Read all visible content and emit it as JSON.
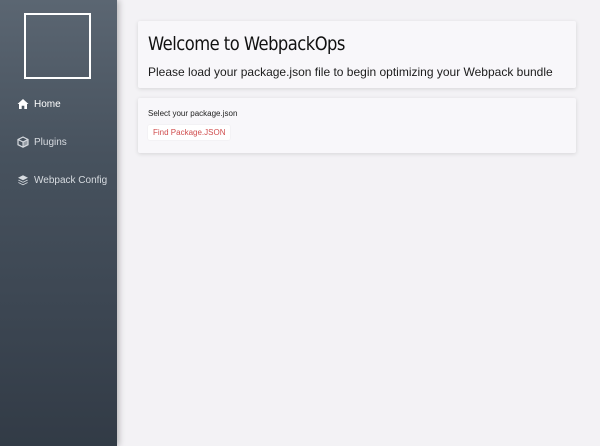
{
  "sidebar": {
    "items": [
      {
        "label": "Home",
        "icon": "home-icon",
        "active": true
      },
      {
        "label": "Plugins",
        "icon": "cube-icon",
        "active": false
      },
      {
        "label": "Webpack Config",
        "icon": "layers-icon",
        "active": false
      }
    ]
  },
  "main": {
    "title": "Welcome to WebpackOps",
    "subtitle": "Please load your package.json file to begin optimizing your Webpack bundle",
    "load_label": "Select your package.json",
    "find_button_label": "Find Package.JSON"
  },
  "colors": {
    "sidebar": "#3c4652",
    "background": "#f3f2f5",
    "card": "#f8f7fa",
    "button_text": "#d04e4e"
  }
}
